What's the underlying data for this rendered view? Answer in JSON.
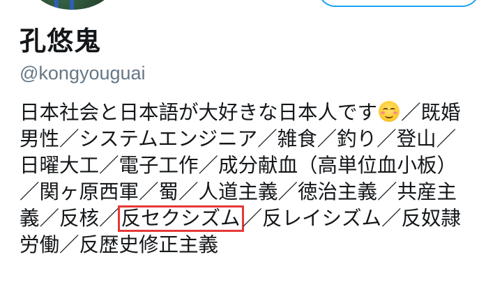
{
  "profile": {
    "display_name": "孔悠鬼",
    "handle": "@kongyouguai",
    "avatar_icon": "profile-photo",
    "follow_button_label": ""
  },
  "bio": {
    "line1_text": "日本社会と日本語が大好きな日本人です",
    "line1_emoji": "smiling-face-with-smiling-eyes",
    "line1_tail": "／既婚",
    "line2": "男性／システムエンジニア／雑食／釣り／登山／",
    "line3": "日曜大工／電子工作／成分献血（高単位血小板）",
    "line4": "／関ヶ原西軍／蜀／人道主義／徳治主義／共産主",
    "line5_before": "義／反核／",
    "line5_highlight": "反セクシズム",
    "line5_after": "／反レイシズム／反奴隷",
    "line6": "労働／反歴史修正主義",
    "highlight_color": "#e53935"
  },
  "colors": {
    "name": "#14171a",
    "handle": "#657786",
    "accent": "#1da1f2"
  }
}
